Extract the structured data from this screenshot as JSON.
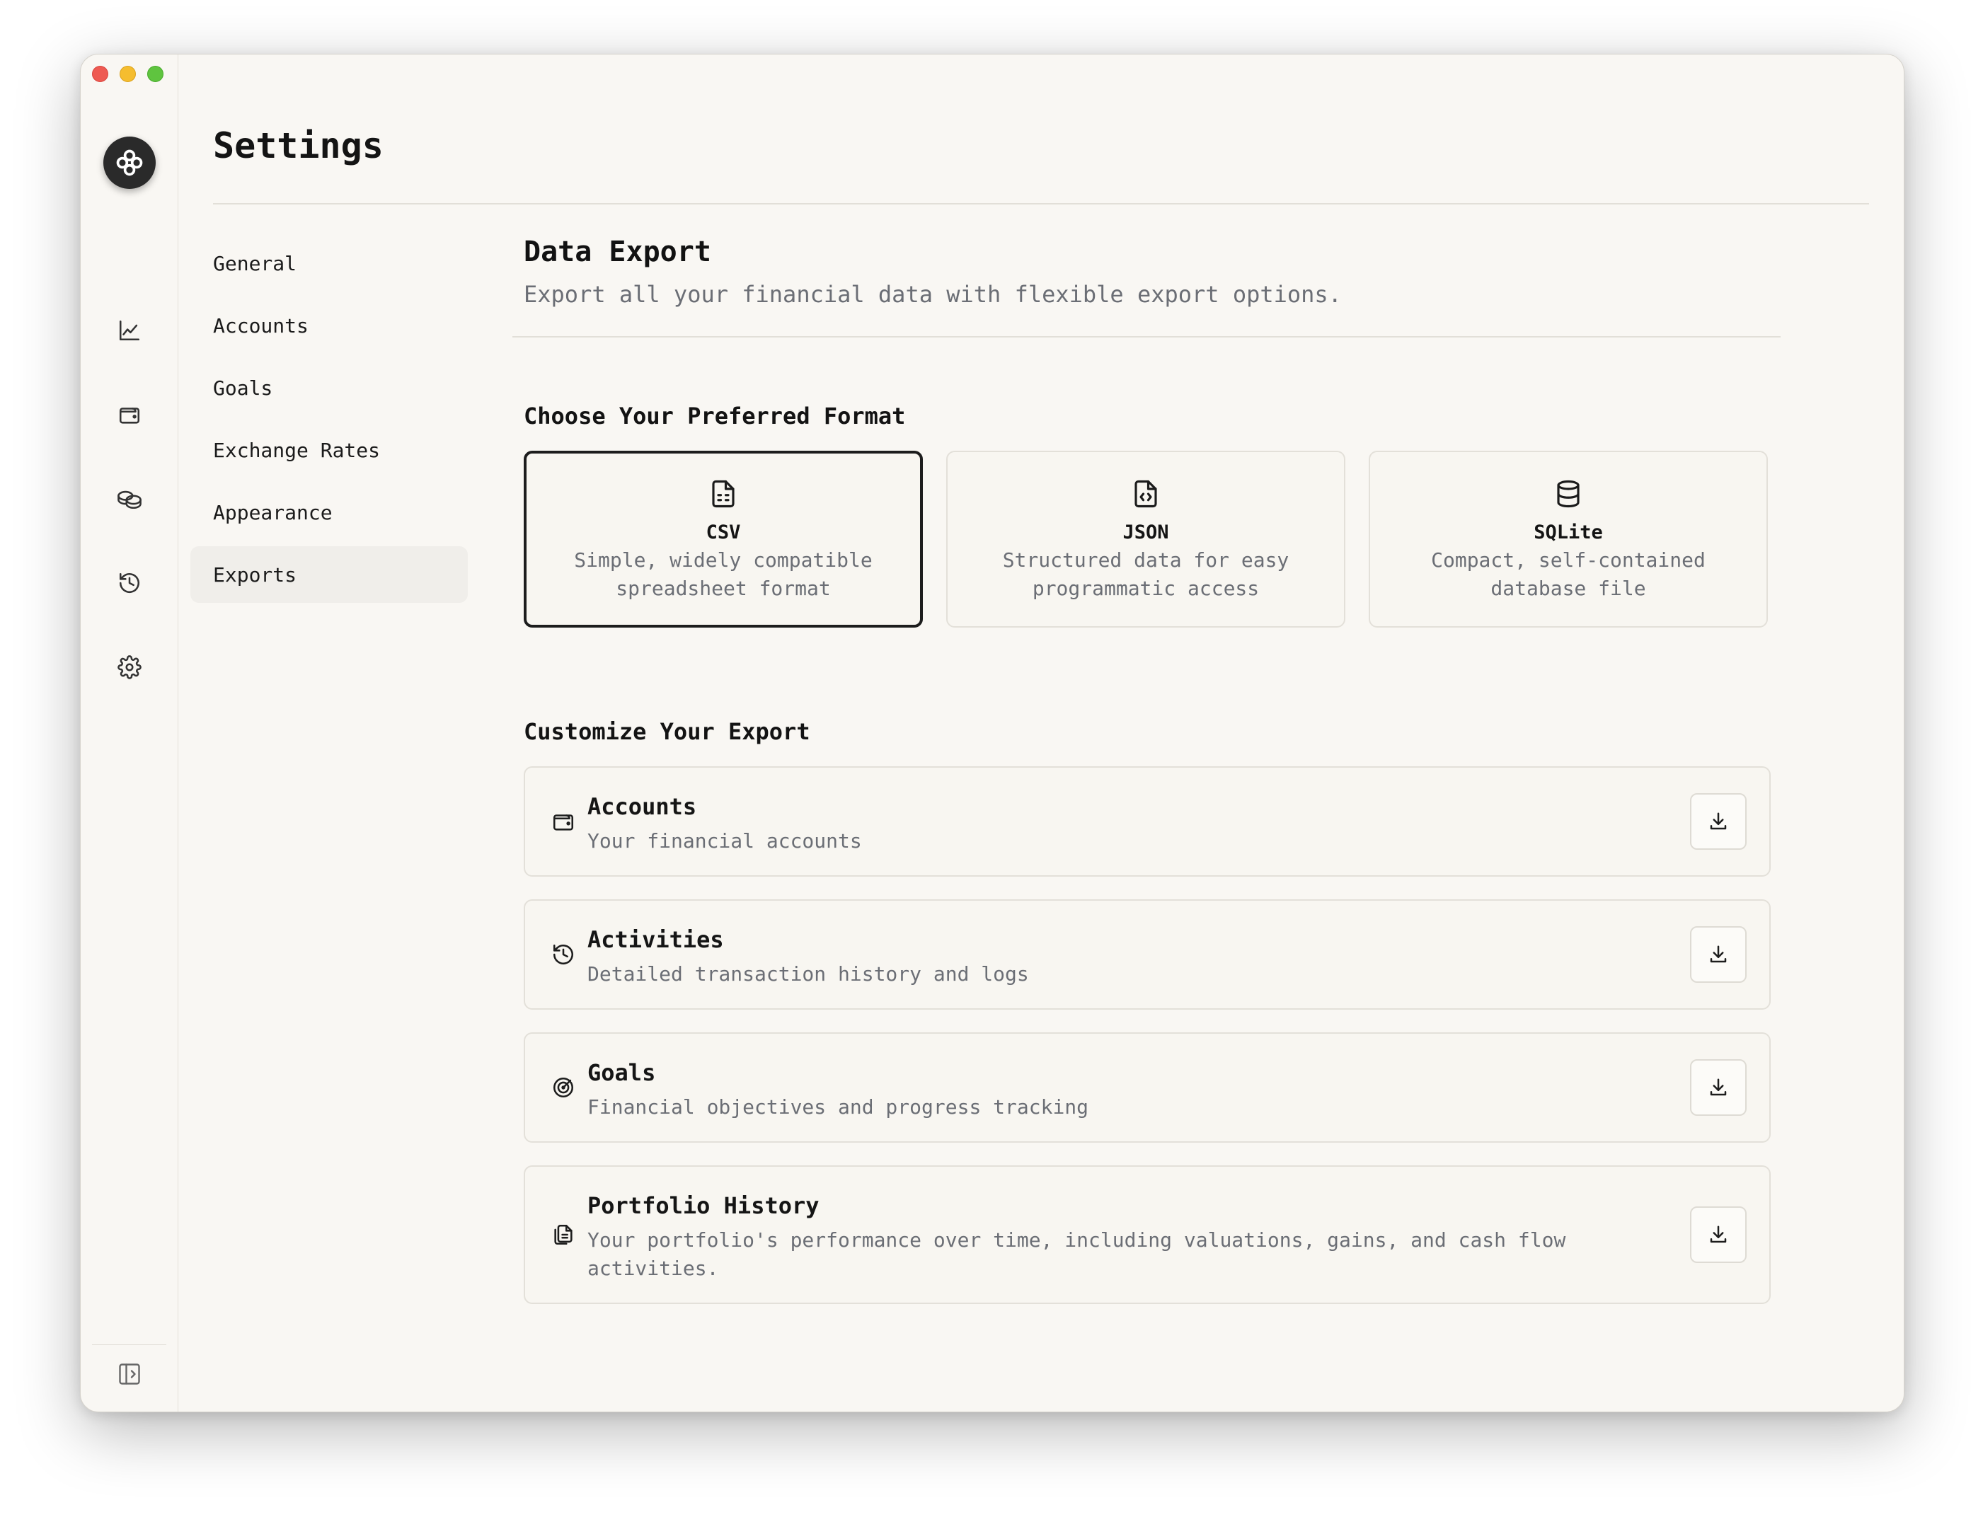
{
  "page": {
    "title": "Settings"
  },
  "rail": {
    "icons": [
      "logo-icon",
      "chart-icon",
      "wallet-icon",
      "coins-icon",
      "history-icon",
      "gear-icon",
      "sidebar-toggle-icon"
    ]
  },
  "subnav": {
    "items": [
      {
        "label": "General"
      },
      {
        "label": "Accounts"
      },
      {
        "label": "Goals"
      },
      {
        "label": "Exchange Rates"
      },
      {
        "label": "Appearance"
      },
      {
        "label": "Exports"
      }
    ],
    "active": "Exports"
  },
  "export": {
    "title": "Data Export",
    "description": "Export all your financial data with flexible export options.",
    "format_heading": "Choose Your Preferred Format",
    "formats": [
      {
        "name": "CSV",
        "desc": "Simple, widely compatible spreadsheet format",
        "icon": "file-spreadsheet-icon",
        "selected": true
      },
      {
        "name": "JSON",
        "desc": "Structured data for easy programmatic access",
        "icon": "file-code-icon",
        "selected": false
      },
      {
        "name": "SQLite",
        "desc": "Compact, self-contained database file",
        "icon": "database-icon",
        "selected": false
      }
    ],
    "customize_heading": "Customize Your Export",
    "items": [
      {
        "title": "Accounts",
        "desc": "Your financial accounts",
        "icon": "wallet-icon"
      },
      {
        "title": "Activities",
        "desc": "Detailed transaction history and logs",
        "icon": "history-icon"
      },
      {
        "title": "Goals",
        "desc": "Financial objectives and progress tracking",
        "icon": "target-icon"
      },
      {
        "title": "Portfolio History",
        "desc": "Your portfolio's performance over time, including valuations, gains, and cash flow activities.",
        "icon": "files-icon"
      }
    ]
  },
  "colors": {
    "background": "#f9f7f3",
    "card": "#f8f6f1",
    "border": "#e3e0d9",
    "text": "#151515",
    "muted": "#6b6e75",
    "selected_border": "#1d1d1d"
  }
}
